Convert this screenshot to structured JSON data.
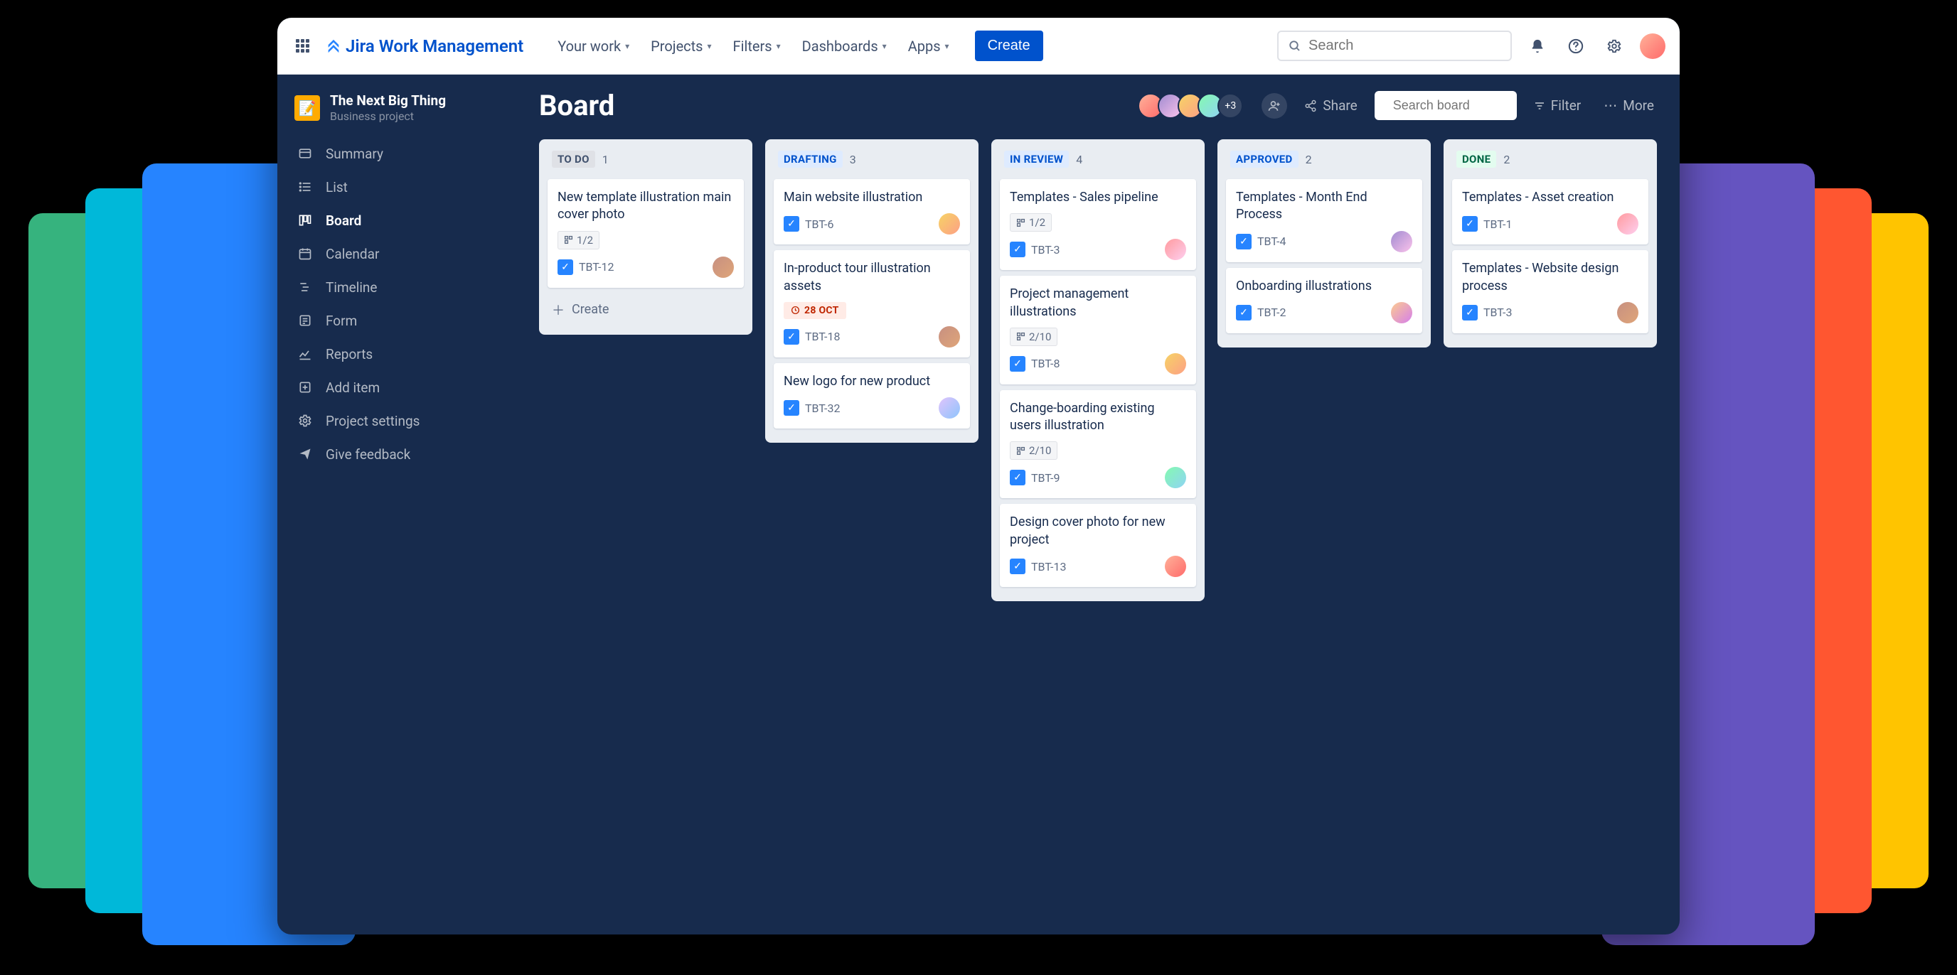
{
  "app": {
    "name": "Jira Work Management",
    "search_placeholder": "Search",
    "create_label": "Create"
  },
  "nav": {
    "items": [
      {
        "label": "Your work"
      },
      {
        "label": "Projects"
      },
      {
        "label": "Filters"
      },
      {
        "label": "Dashboards"
      },
      {
        "label": "Apps"
      }
    ]
  },
  "project": {
    "name": "The Next Big Thing",
    "type": "Business project"
  },
  "sidebar": {
    "items": [
      {
        "label": "Summary"
      },
      {
        "label": "List"
      },
      {
        "label": "Board"
      },
      {
        "label": "Calendar"
      },
      {
        "label": "Timeline"
      },
      {
        "label": "Form"
      },
      {
        "label": "Reports"
      },
      {
        "label": "Add item"
      },
      {
        "label": "Project settings"
      },
      {
        "label": "Give feedback"
      }
    ]
  },
  "board": {
    "title": "Board",
    "avatar_overflow": "+3",
    "share_label": "Share",
    "search_placeholder": "Search board",
    "filter_label": "Filter",
    "more_label": "More",
    "create_label": "Create"
  },
  "columns": [
    {
      "name": "TO DO",
      "badge_class": "",
      "count": "1",
      "cards": [
        {
          "title": "New template illustration main cover photo",
          "subtasks": "1/2",
          "key": "TBT-12",
          "assignee": "av-g"
        }
      ],
      "show_create": true
    },
    {
      "name": "DRAFTING",
      "badge_class": "drafting",
      "count": "3",
      "cards": [
        {
          "title": "Main website illustration",
          "key": "TBT-6",
          "assignee": "av-c"
        },
        {
          "title": "In-product tour illustration assets",
          "date": "28 OCT",
          "key": "TBT-18",
          "assignee": "av-g"
        },
        {
          "title": "New logo for new product",
          "key": "TBT-32",
          "assignee": "av-f"
        }
      ]
    },
    {
      "name": "IN REVIEW",
      "badge_class": "inreview",
      "count": "4",
      "cards": [
        {
          "title": "Templates - Sales pipeline",
          "subtasks": "1/2",
          "key": "TBT-3",
          "assignee": "av-h"
        },
        {
          "title": "Project management illustrations",
          "subtasks": "2/10",
          "key": "TBT-8",
          "assignee": "av-c"
        },
        {
          "title": "Change-boarding existing users illustration",
          "subtasks": "2/10",
          "key": "TBT-9",
          "assignee": "av-d"
        },
        {
          "title": "Design cover photo for new project",
          "key": "TBT-13",
          "assignee": "av-a"
        }
      ]
    },
    {
      "name": "APPROVED",
      "badge_class": "approved",
      "count": "2",
      "cards": [
        {
          "title": "Templates - Month End Process",
          "key": "TBT-4",
          "assignee": "av-b"
        },
        {
          "title": "Onboarding illustrations",
          "key": "TBT-2",
          "assignee": "av-e"
        }
      ]
    },
    {
      "name": "DONE",
      "badge_class": "done",
      "count": "2",
      "cards": [
        {
          "title": "Templates - Asset creation",
          "key": "TBT-1",
          "assignee": "av-h"
        },
        {
          "title": "Templates - Website design process",
          "key": "TBT-3",
          "assignee": "av-g"
        }
      ]
    }
  ]
}
